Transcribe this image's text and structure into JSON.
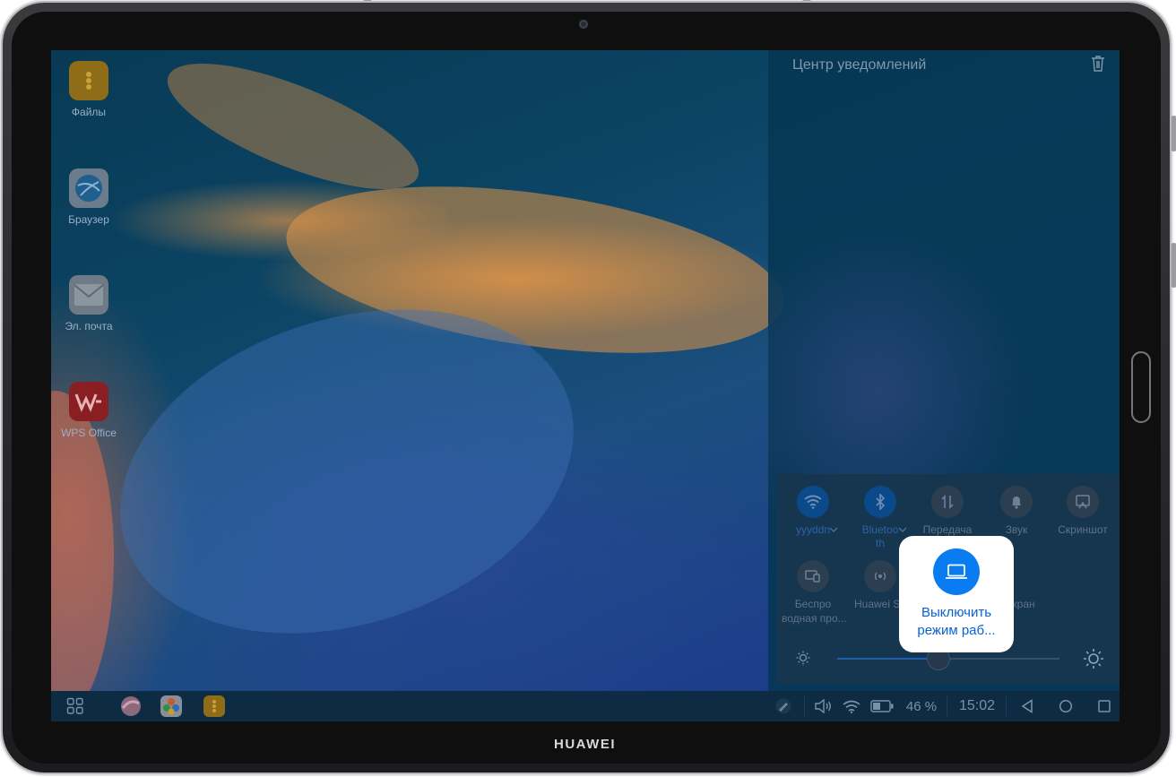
{
  "device": {
    "brand": "HUAWEI"
  },
  "desktop": {
    "icons": [
      {
        "label": "Файлы",
        "icon": "files-icon"
      },
      {
        "label": "Браузер",
        "icon": "browser-icon"
      },
      {
        "label": "Эл. почта",
        "icon": "mail-icon"
      },
      {
        "label": "WPS Office",
        "icon": "wps-office-icon"
      }
    ]
  },
  "notification_center": {
    "title": "Центр уведомлений",
    "clear_icon": "trash-icon"
  },
  "quick_settings": {
    "tiles": [
      {
        "label": "yyyddn",
        "icon": "wifi-icon",
        "active": true
      },
      {
        "label": "Bluetoo",
        "label2": "th",
        "icon": "bluetooth-icon",
        "active": true
      },
      {
        "label": "Передача",
        "icon": "data-transfer-icon",
        "active": false
      },
      {
        "label": "Звук",
        "icon": "bell-icon",
        "active": false
      },
      {
        "label": "Скриншот",
        "icon": "screenshot-icon",
        "active": false
      },
      {
        "label": "Беспро",
        "label2": "водная про...",
        "icon": "wireless-projection-icon",
        "active": false
      },
      {
        "label": "Huawei Sh",
        "icon": "huawei-share-icon",
        "active": false
      },
      {
        "label": "экран",
        "icon": "screen-icon",
        "active": false
      }
    ],
    "brightness": {
      "level": 0.45
    }
  },
  "popup": {
    "line1": "Выключить",
    "line2": "режим раб...",
    "icon": "laptop-icon"
  },
  "taskbar": {
    "battery": "46 %",
    "time": "15:02"
  },
  "colors": {
    "accent": "#0a7cf2",
    "popup_text": "#0a62d0"
  }
}
